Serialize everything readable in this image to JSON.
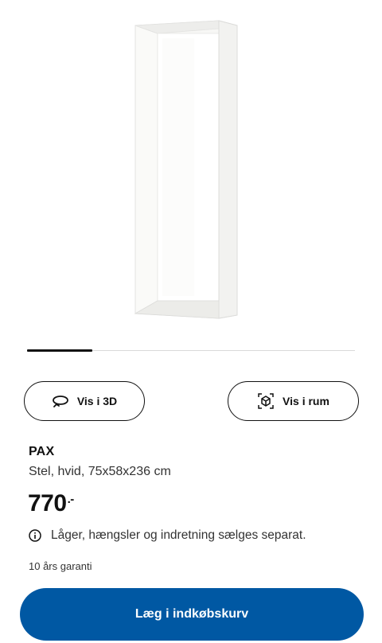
{
  "product": {
    "name": "PAX",
    "description": "Stel, hvid, 75x58x236 cm",
    "price_integer": "770",
    "price_suffix": ".-",
    "notice": "Låger, hængsler og indretning sælges separat.",
    "warranty": "10 års garanti"
  },
  "buttons": {
    "view_3d": "Vis i 3D",
    "view_in_room": "Vis i rum",
    "add_to_cart": "Læg i indkøbskurv"
  },
  "carousel": {
    "progress": 0.2
  },
  "icons": {
    "view_3d": "rotate-3d-icon",
    "view_in_room": "ar-cube-icon",
    "notice": "info-icon"
  },
  "colors": {
    "primary_button": "#0058a3",
    "text": "#111111"
  }
}
